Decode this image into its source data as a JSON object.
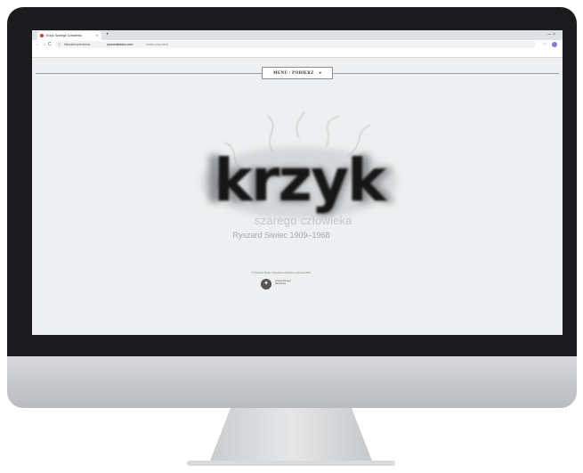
{
  "browser": {
    "tab_title": "Krzyk Szarego Człowieka",
    "tab_close": "×",
    "new_tab": "+",
    "window_controls": "— ×",
    "nav_back": "←",
    "nav_forward": "→",
    "nav_reload": "C",
    "url_security": "Niezabezpieczona",
    "url_domain": "ryszardsiwiec.com",
    "url_path": "/index.php.html",
    "bookmarks": [
      "Aplikacje",
      "http://blogalacup50/",
      "Nowa karta",
      "Trello",
      "Lorem Ipsum",
      "CUT THE IDEA",
      "Fontex",
      "Blog",
      "Raspberry Pi",
      "web designs",
      "Photography",
      "Spanish",
      "Szablon",
      "http://plzipsum.com/",
      "Muzzle Google Play",
      "Extension"
    ]
  },
  "site": {
    "menu_label": "MENU / POBIERZ",
    "menu_arrow": "▾",
    "logo_word": "krzyk",
    "subtitle": "szarego człowieka",
    "author": "Ryszard Siwiec 1909–1968",
    "copyright": "© Ryszard Siwiec Narodowe Archiwum Cyfrowe 2014",
    "emblem_text": "Instytut Pamięci Narodowej"
  },
  "colors": {
    "page_bg": "#edeff0",
    "logo_ink": "#141414"
  }
}
